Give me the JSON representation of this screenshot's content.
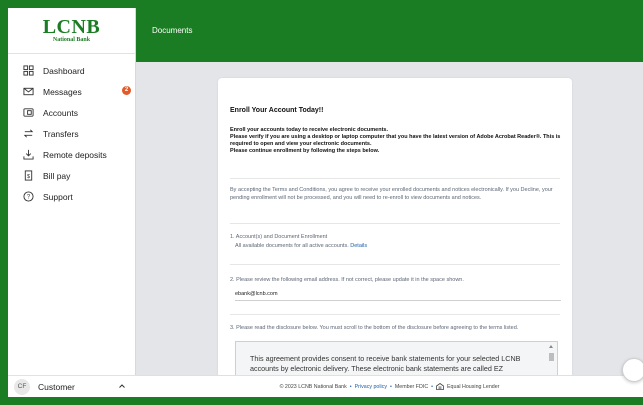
{
  "brand": {
    "logo_main": "LCNB",
    "logo_sub": "National Bank",
    "accent": "#1b7d23"
  },
  "sidebar": {
    "items": [
      {
        "label": "Dashboard",
        "icon": "dashboard-icon"
      },
      {
        "label": "Messages",
        "icon": "mail-icon",
        "badge": "2"
      },
      {
        "label": "Accounts",
        "icon": "accounts-icon"
      },
      {
        "label": "Transfers",
        "icon": "transfers-icon"
      },
      {
        "label": "Remote deposits",
        "icon": "deposit-icon"
      },
      {
        "label": "Bill pay",
        "icon": "bill-icon"
      },
      {
        "label": "Support",
        "icon": "help-icon"
      }
    ]
  },
  "user": {
    "initials": "CF",
    "name": "Customer"
  },
  "header": {
    "title": "Documents"
  },
  "enroll": {
    "title": "Enroll Your Account Today!!",
    "intro_1": "Enroll your accounts today to receive electronic documents.",
    "intro_2": "Please verify if you are using a desktop or laptop computer that you have the latest version of Adobe Acrobat Reader®. This is required to open and view your electronic documents.",
    "intro_3": "Please continue enrollment by following the steps below.",
    "terms": "By accepting the Terms and Conditions, you agree to receive your enrolled documents and notices electronically. If you Decline, your pending enrollment will not be processed, and you will need to re-enroll to view documents and notices.",
    "step1_title": "1. Account(s) and Document Enrollment",
    "step1_text": "All available documents for all active accounts.",
    "step1_link": "Details",
    "step2_title": "2. Please review the following email address. If not correct, please update it in the space shown.",
    "email": "ebank@lcnb.com",
    "step3_title": "3. Please read the disclosure below. You must scroll to the bottom of the disclosure before agreeing to the terms listed.",
    "disclosure": "This agreement provides consent to receive bank statements for your selected LCNB accounts by electronic delivery. These electronic bank statements are called EZ Statements."
  },
  "footer": {
    "copyright": "© 2023 LCNB National Bank",
    "privacy": "Privacy policy",
    "fdic": "Member FDIC",
    "housing": "Equal Housing Lender"
  }
}
